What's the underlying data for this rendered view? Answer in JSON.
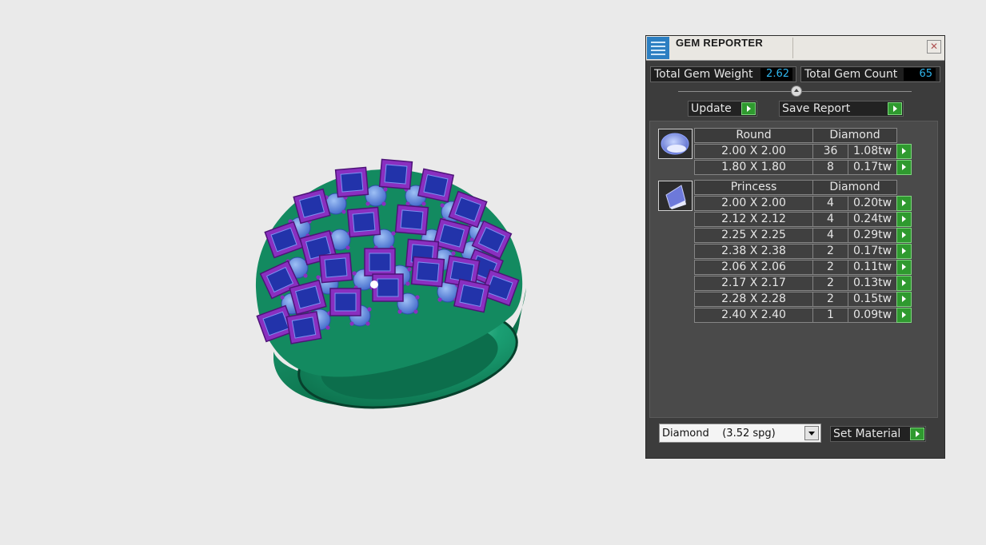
{
  "panel": {
    "title": "GEM REPORTER",
    "close_glyph": "✕",
    "icon": "gem-reporter-app-icon",
    "total_weight_label": "Total Gem Weight",
    "total_weight_value": "2.62",
    "total_count_label": "Total Gem Count",
    "total_count_value": "65",
    "update_label": "Update",
    "save_label": "Save Report",
    "groups": [
      {
        "shape": "Round",
        "material": "Diamond",
        "icon": "round-gem-icon",
        "rows": [
          {
            "size": "2.00 X 2.00",
            "count": "36",
            "weight": "1.08tw"
          },
          {
            "size": "1.80 X 1.80",
            "count": "8",
            "weight": "0.17tw"
          }
        ]
      },
      {
        "shape": "Princess",
        "material": "Diamond",
        "icon": "princess-gem-icon",
        "rows": [
          {
            "size": "2.00 X 2.00",
            "count": "4",
            "weight": "0.20tw"
          },
          {
            "size": "2.12 X 2.12",
            "count": "4",
            "weight": "0.24tw"
          },
          {
            "size": "2.25 X 2.25",
            "count": "4",
            "weight": "0.29tw"
          },
          {
            "size": "2.38 X 2.38",
            "count": "2",
            "weight": "0.17tw"
          },
          {
            "size": "2.06 X 2.06",
            "count": "2",
            "weight": "0.11tw"
          },
          {
            "size": "2.17 X 2.17",
            "count": "2",
            "weight": "0.13tw"
          },
          {
            "size": "2.28 X 2.28",
            "count": "2",
            "weight": "0.15tw"
          },
          {
            "size": "2.40 X 2.40",
            "count": "1",
            "weight": "0.09tw"
          }
        ]
      }
    ],
    "material_select": "Diamond    (3.52 spg)",
    "set_material_label": "Set Material"
  },
  "colors": {
    "metal": "#12805a",
    "prong": "#8a2fc0",
    "princess_stone": "#2233aa",
    "round_stone": "#5c8bdc",
    "accent_button": "#2f9a2f",
    "value_text": "#2fb6ee"
  }
}
